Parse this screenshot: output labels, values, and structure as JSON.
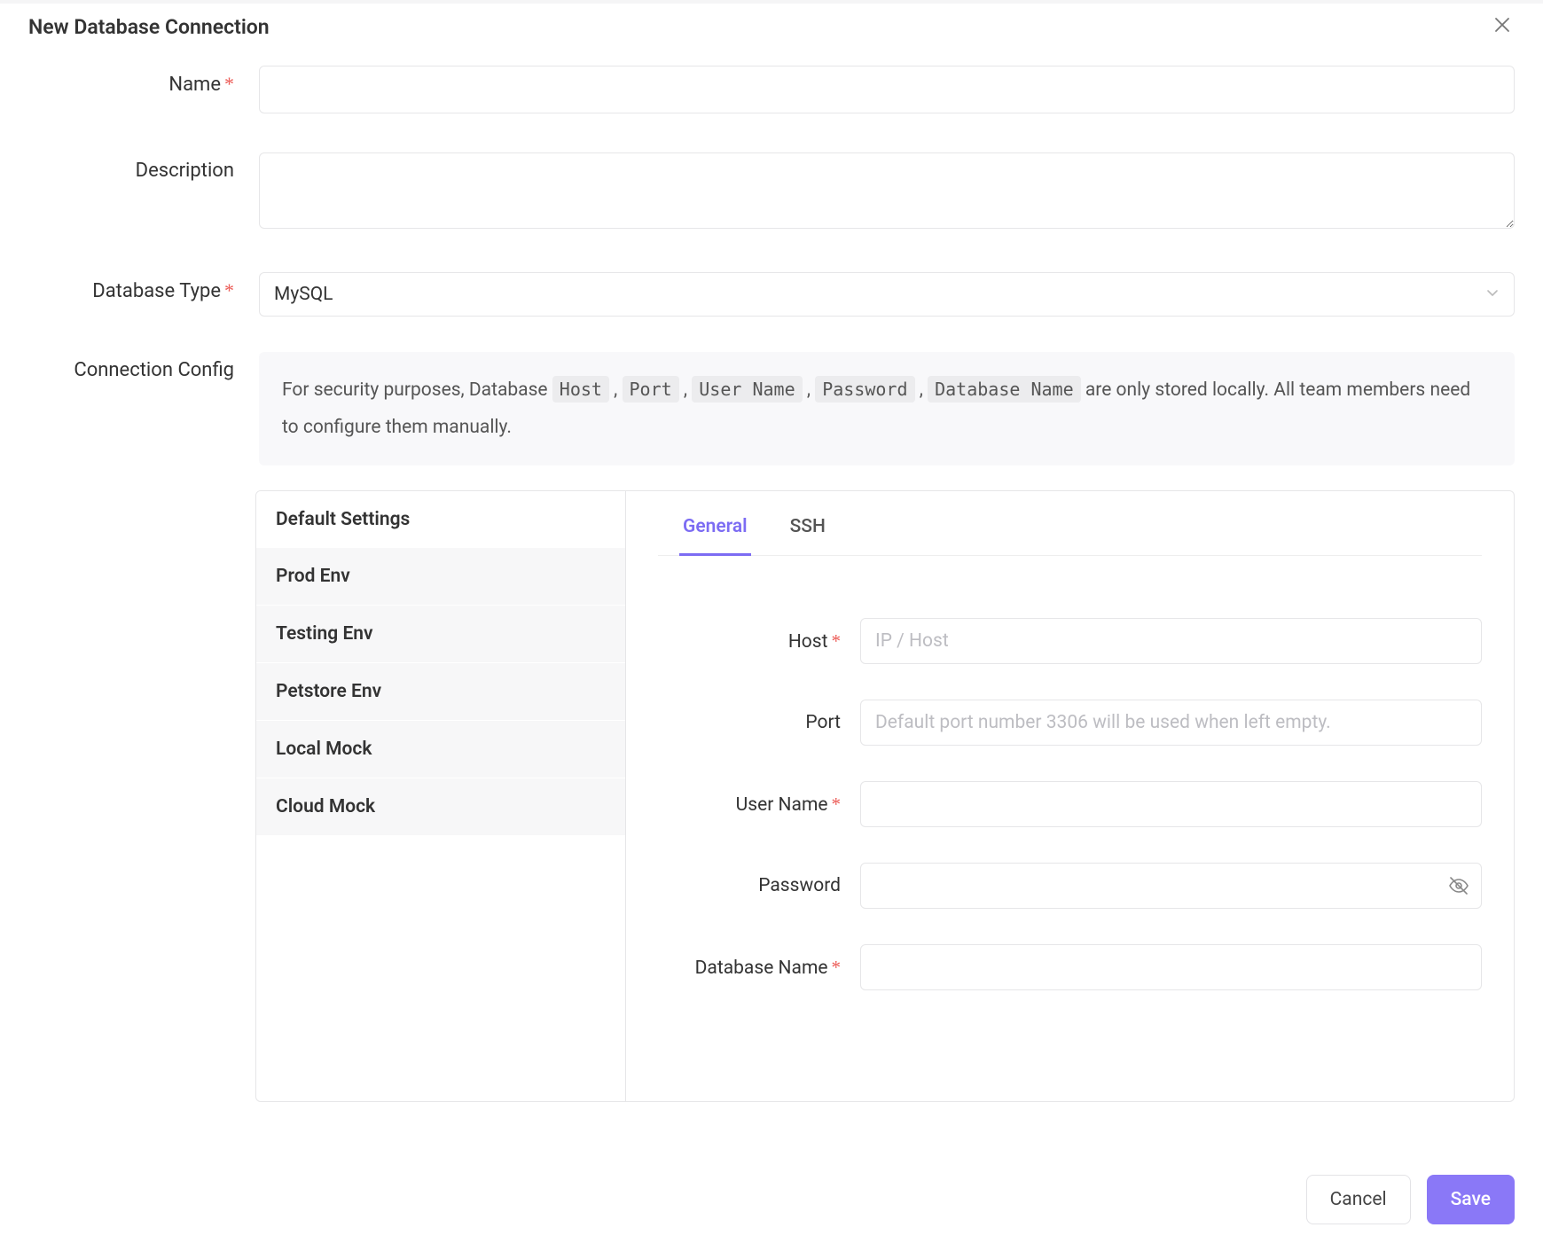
{
  "modalTitle": "New Database Connection",
  "labels": {
    "name": "Name",
    "description": "Description",
    "databaseType": "Database Type",
    "connectionConfig": "Connection Config"
  },
  "databaseTypeValue": "MySQL",
  "notice": {
    "prefix": "For security purposes, Database ",
    "tokens": {
      "host": "Host",
      "port": "Port",
      "user": "User Name",
      "password": "Password",
      "dbname": "Database Name"
    },
    "sep": " ,  ",
    "suffix": " are only stored locally. All team members need to configure them manually."
  },
  "envHeader": "Default Settings",
  "envs": [
    {
      "label": "Prod Env"
    },
    {
      "label": "Testing Env"
    },
    {
      "label": "Petstore Env"
    },
    {
      "label": "Local Mock"
    },
    {
      "label": "Cloud Mock"
    }
  ],
  "tabs": {
    "general": "General",
    "ssh": "SSH"
  },
  "fields": {
    "host": {
      "label": "Host",
      "placeholder": "IP / Host"
    },
    "port": {
      "label": "Port",
      "placeholder": "Default port number 3306 will be used when left empty."
    },
    "user": {
      "label": "User Name",
      "placeholder": ""
    },
    "password": {
      "label": "Password",
      "placeholder": ""
    },
    "dbname": {
      "label": "Database Name",
      "placeholder": ""
    }
  },
  "buttons": {
    "cancel": "Cancel",
    "save": "Save"
  }
}
